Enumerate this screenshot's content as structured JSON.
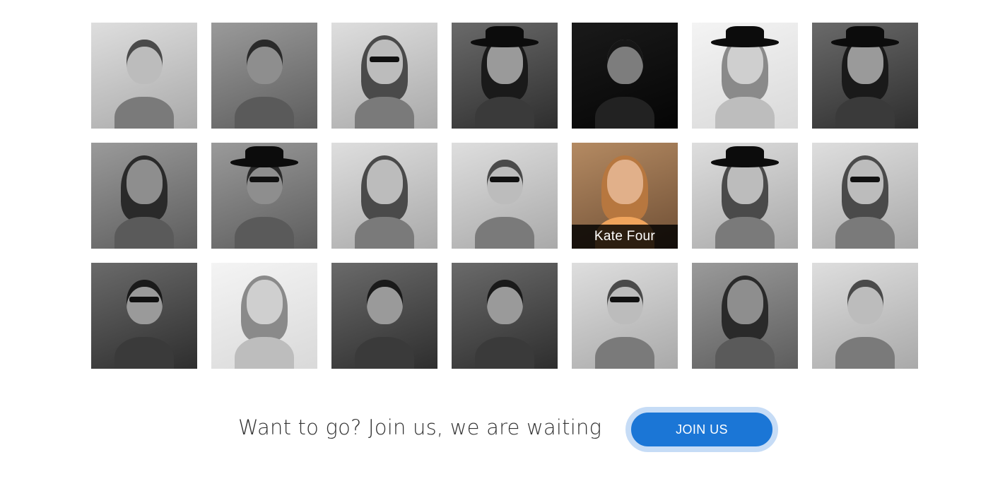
{
  "gallery": {
    "rows": [
      [
        {
          "name": "",
          "color": false,
          "tone": "light",
          "hat": false,
          "glasses": false,
          "long_hair": false
        },
        {
          "name": "",
          "color": false,
          "tone": "mid",
          "hat": false,
          "glasses": false,
          "long_hair": false
        },
        {
          "name": "",
          "color": false,
          "tone": "light",
          "hat": false,
          "glasses": true,
          "long_hair": true
        },
        {
          "name": "",
          "color": false,
          "tone": "dark",
          "hat": true,
          "glasses": false,
          "long_hair": true
        },
        {
          "name": "",
          "color": false,
          "tone": "black",
          "hat": false,
          "glasses": false,
          "long_hair": false
        },
        {
          "name": "",
          "color": false,
          "tone": "white",
          "hat": true,
          "glasses": false,
          "long_hair": true
        },
        {
          "name": "",
          "color": false,
          "tone": "dark",
          "hat": true,
          "glasses": false,
          "long_hair": true
        }
      ],
      [
        {
          "name": "",
          "color": false,
          "tone": "mid",
          "hat": false,
          "glasses": false,
          "long_hair": true
        },
        {
          "name": "",
          "color": false,
          "tone": "mid",
          "hat": true,
          "glasses": true,
          "long_hair": false
        },
        {
          "name": "",
          "color": false,
          "tone": "light",
          "hat": false,
          "glasses": false,
          "long_hair": true
        },
        {
          "name": "",
          "color": false,
          "tone": "light",
          "hat": false,
          "glasses": true,
          "long_hair": false
        },
        {
          "name": "Kate Four",
          "color": true,
          "tone": "warm",
          "hat": false,
          "glasses": false,
          "long_hair": true
        },
        {
          "name": "",
          "color": false,
          "tone": "light",
          "hat": true,
          "glasses": false,
          "long_hair": true
        },
        {
          "name": "",
          "color": false,
          "tone": "light",
          "hat": false,
          "glasses": true,
          "long_hair": true
        }
      ],
      [
        {
          "name": "",
          "color": false,
          "tone": "dark",
          "hat": false,
          "glasses": true,
          "long_hair": false
        },
        {
          "name": "",
          "color": false,
          "tone": "white",
          "hat": false,
          "glasses": false,
          "long_hair": true
        },
        {
          "name": "",
          "color": false,
          "tone": "dark",
          "hat": false,
          "glasses": false,
          "long_hair": false
        },
        {
          "name": "",
          "color": false,
          "tone": "dark",
          "hat": false,
          "glasses": false,
          "long_hair": false
        },
        {
          "name": "",
          "color": false,
          "tone": "light",
          "hat": false,
          "glasses": true,
          "long_hair": false
        },
        {
          "name": "",
          "color": false,
          "tone": "mid",
          "hat": false,
          "glasses": false,
          "long_hair": true
        },
        {
          "name": "",
          "color": false,
          "tone": "light",
          "hat": false,
          "glasses": false,
          "long_hair": false
        }
      ]
    ]
  },
  "cta": {
    "text": "Want to go? Join us, we are waiting",
    "button_label": "JOIN US"
  },
  "colors": {
    "button": "#1b76d6",
    "button_ring": "#c6dcf6",
    "text": "#333333",
    "caption_bg": "#000000"
  }
}
